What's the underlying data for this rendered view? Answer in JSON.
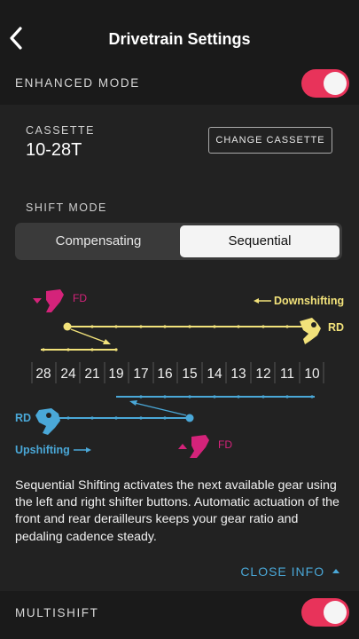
{
  "header": {
    "title": "Drivetrain Settings"
  },
  "enhanced_mode": {
    "label": "ENHANCED MODE",
    "enabled": true
  },
  "cassette": {
    "label": "CASSETTE",
    "value": "10-28T",
    "change_label": "CHANGE CASSETTE"
  },
  "shift_mode": {
    "label": "SHIFT MODE",
    "options": [
      "Compensating",
      "Sequential"
    ],
    "selected": "Sequential"
  },
  "diagram": {
    "fd_label": "FD",
    "rd_label": "RD",
    "downshifting_label": "Downshifting",
    "upshifting_label": "Upshifting",
    "cogs": [
      "28",
      "24",
      "21",
      "19",
      "17",
      "16",
      "15",
      "14",
      "13",
      "12",
      "11",
      "10"
    ]
  },
  "info_text": "Sequential Shifting activates the next available gear using the left and right shifter buttons. Automatic actuation of the front and rear derailleurs keeps your gear ratio and pedaling cadence steady.",
  "close_info": "CLOSE INFO",
  "multishift": {
    "label": "MULTISHIFT",
    "enabled": true
  },
  "colors": {
    "accent_toggle": "#e8335a",
    "yellow": "#f2e27a",
    "blue": "#4aa8d8",
    "magenta": "#d4237a"
  }
}
